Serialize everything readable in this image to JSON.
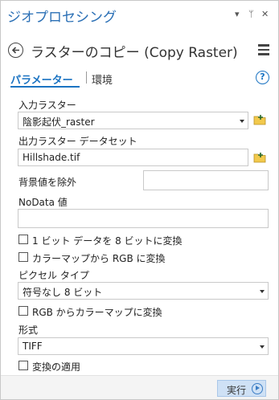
{
  "pane": {
    "title": "ジオプロセシング",
    "controls": {
      "dropdown": "▾",
      "pin": "ᛘ",
      "close": "✕"
    }
  },
  "tool": {
    "title": "ラスターのコピー (Copy Raster)"
  },
  "tabs": {
    "parameters": "パラメーター",
    "environments": "環境",
    "help": "?"
  },
  "params": {
    "input_raster": {
      "label": "入力ラスター",
      "value": "陰影起伏_raster"
    },
    "output_dataset": {
      "label": "出力ラスター データセット",
      "value": "Hillshade.tif"
    },
    "ignore_background": {
      "label": "背景値を除外",
      "value": ""
    },
    "nodata": {
      "label": "NoData 値",
      "value": ""
    },
    "convert_1bit": {
      "label": "1 ビット データを 8 ビットに変換",
      "checked": false
    },
    "colormap_to_rgb": {
      "label": "カラーマップから RGB に変換",
      "checked": false
    },
    "pixel_type": {
      "label": "ピクセル タイプ",
      "value": "符号なし 8 ビット"
    },
    "rgb_to_colormap": {
      "label": "RGB からカラーマップに変換",
      "checked": false
    },
    "format": {
      "label": "形式",
      "value": "TIFF"
    },
    "apply_transform": {
      "label": "変換の適用",
      "checked": false
    }
  },
  "footer": {
    "run_label": "実行"
  },
  "colors": {
    "accent": "#1a73c2",
    "title": "#2a6fb5",
    "run_button": "#cfe1f5",
    "folder_icon": "#f2c94c"
  }
}
